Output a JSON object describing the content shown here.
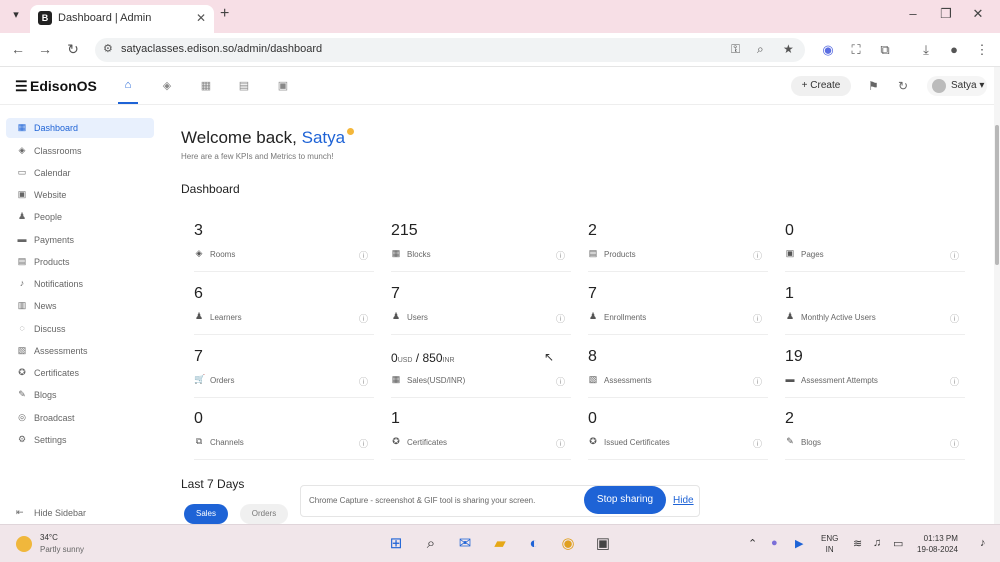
{
  "browser": {
    "tab_title": "Dashboard | Admin",
    "favicon_letter": "B",
    "url": "satyaclasses.edison.so/admin/dashboard"
  },
  "app": {
    "logo": "EdisonOS",
    "create_label": "+ Create",
    "user_name": "Satya ▾"
  },
  "sidebar": {
    "items": [
      {
        "label": "Dashboard",
        "icon": "grid-icon"
      },
      {
        "label": "Classrooms",
        "icon": "layers-icon"
      },
      {
        "label": "Calendar",
        "icon": "calendar-icon"
      },
      {
        "label": "Website",
        "icon": "globe-icon"
      },
      {
        "label": "People",
        "icon": "people-icon"
      },
      {
        "label": "Payments",
        "icon": "card-icon"
      },
      {
        "label": "Products",
        "icon": "box-icon"
      },
      {
        "label": "Notifications",
        "icon": "bell-icon"
      },
      {
        "label": "News",
        "icon": "news-icon"
      },
      {
        "label": "Discuss",
        "icon": "chat-icon"
      },
      {
        "label": "Assessments",
        "icon": "assessment-icon"
      },
      {
        "label": "Certificates",
        "icon": "certificate-icon"
      },
      {
        "label": "Blogs",
        "icon": "blog-icon"
      },
      {
        "label": "Broadcast",
        "icon": "broadcast-icon"
      },
      {
        "label": "Settings",
        "icon": "gear-icon"
      }
    ],
    "hide_label": "Hide Sidebar"
  },
  "main": {
    "welcome": "Welcome back,",
    "user": "Satya",
    "subtitle": "Here are a few KPIs and Metrics to munch!",
    "dashboard_title": "Dashboard",
    "kpis": [
      {
        "value": "3",
        "label": "Rooms"
      },
      {
        "value": "215",
        "label": "Blocks"
      },
      {
        "value": "2",
        "label": "Products"
      },
      {
        "value": "0",
        "label": "Pages"
      },
      {
        "value": "6",
        "label": "Learners"
      },
      {
        "value": "7",
        "label": "Users"
      },
      {
        "value": "7",
        "label": "Enrollments"
      },
      {
        "value": "1",
        "label": "Monthly Active Users"
      },
      {
        "value": "7",
        "label": "Orders"
      },
      {
        "value": "0",
        "value_unit": "USD",
        "value2": " / 850",
        "value2_unit": "INR",
        "label": "Sales(USD/INR)"
      },
      {
        "value": "8",
        "label": "Assessments"
      },
      {
        "value": "19",
        "label": "Assessment Attempts"
      },
      {
        "value": "0",
        "label": "Channels"
      },
      {
        "value": "1",
        "label": "Certificates"
      },
      {
        "value": "0",
        "label": "Issued Certificates"
      },
      {
        "value": "2",
        "label": "Blogs"
      }
    ],
    "last7_title": "Last 7 Days",
    "tab_sales": "Sales",
    "tab_orders": "Orders"
  },
  "share_banner": {
    "message": "Chrome Capture - screenshot & GIF tool is sharing your screen.",
    "stop_label": "Stop sharing",
    "hide_label": "Hide"
  },
  "taskbar": {
    "temp": "34°C",
    "weather": "Partly sunny",
    "lang1": "ENG",
    "lang2": "IN",
    "time": "01:13 PM",
    "date": "19-08-2024"
  },
  "colors": {
    "accent": "#1e63d6",
    "tab_strip": "#f7dfe6",
    "taskbar": "#f1e6ea"
  }
}
